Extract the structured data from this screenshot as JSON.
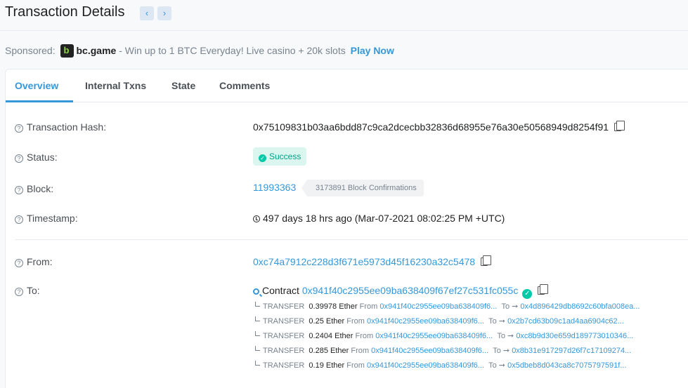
{
  "header": {
    "title": "Transaction Details",
    "prev": "‹",
    "next": "›"
  },
  "sponsored": {
    "label": "Sponsored:",
    "brand": "bc.game",
    "text": " - Win up to 1 BTC Everyday! Live casino + 20k slots",
    "cta": "Play Now"
  },
  "tabs": [
    "Overview",
    "Internal Txns",
    "State",
    "Comments"
  ],
  "overview": {
    "hash_label": "Transaction Hash:",
    "hash": "0x75109831b03aa6bdd87c9ca2dcecbb32836d68955e76a30e50568949d8254f91",
    "status_label": "Status:",
    "status": "Success",
    "block_label": "Block:",
    "block": "11993363",
    "confirmations": "3173891 Block Confirmations",
    "timestamp_label": "Timestamp:",
    "timestamp": "497 days 18 hrs ago (Mar-07-2021 08:02:25 PM +UTC)",
    "from_label": "From:",
    "from": "0xc74a7912c228d3f671e5973d45f16230a32c5478",
    "to_label": "To:",
    "to_prefix": "Contract",
    "to": "0x941f40c2955ee09ba638409f67ef27c531fc055c"
  },
  "transfers": [
    {
      "kind": "TRANSFER",
      "amount": "0.39978",
      "unit": "Ether",
      "from_word": "From",
      "from": "0x941f40c2955ee09ba638409f6...",
      "to_word": "To",
      "to": "0x4d896429db8692c60bfa008ea..."
    },
    {
      "kind": "TRANSFER",
      "amount": "0.25",
      "unit": "Ether",
      "from_word": "From",
      "from": "0x941f40c2955ee09ba638409f6...",
      "to_word": "To",
      "to": "0x2b7cd63b09c1ad4aa6904c62..."
    },
    {
      "kind": "TRANSFER",
      "amount": "0.2404",
      "unit": "Ether",
      "from_word": "From",
      "from": "0x941f40c2955ee09ba638409f6...",
      "to_word": "To",
      "to": "0xc8b9d30e659d189773010346..."
    },
    {
      "kind": "TRANSFER",
      "amount": "0.285",
      "unit": "Ether",
      "from_word": "From",
      "from": "0x941f40c2955ee09ba638409f6...",
      "to_word": "To",
      "to": "0x8b31e917297d26f7c17109274..."
    },
    {
      "kind": "TRANSFER",
      "amount": "0.19",
      "unit": "Ether",
      "from_word": "From",
      "from": "0x941f40c2955ee09ba638409f6...",
      "to_word": "To",
      "to": "0x5dbeb8d043ca8c7075797591f..."
    }
  ],
  "colors": {
    "accent": "#3498db",
    "success": "#00c9a7"
  }
}
